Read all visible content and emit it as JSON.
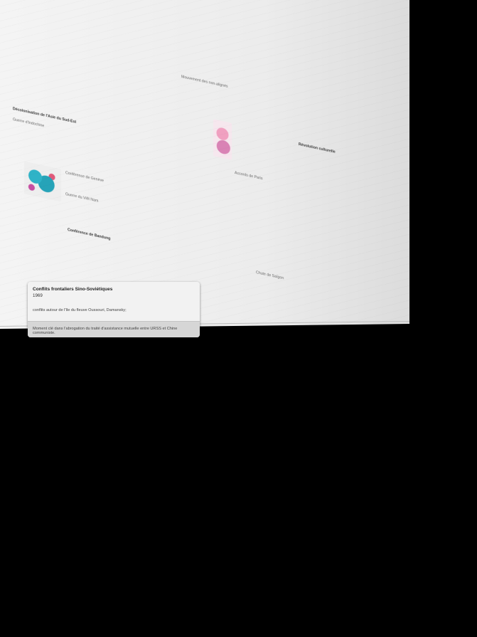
{
  "background": {
    "wall_color": "#eeeeee",
    "outside_color": "#000000"
  },
  "wall_snippets": [
    "Conflits frontaliers Sino-Soviétiques",
    "Décolonisation de l'Asie du Sud-Est",
    "Guerre d'Indochine",
    "Conférence de Genève",
    "Guerre du Viêt Nam",
    "Conférence de Bandung",
    "Mouvement des non-alignés",
    "Accords de Paris",
    "Chute de Saïgon",
    "Révolution culturelle"
  ],
  "event_card": {
    "title": "Conflits frontaliers Sino-Soviétiques",
    "year": "1969",
    "description": "conflits autour de l'île du fleuve Oussouri, Damansky;",
    "footer": "Moment clé dans l'abrogation du traité d'assistance mutuelle entre URSS et Chine communiste."
  }
}
